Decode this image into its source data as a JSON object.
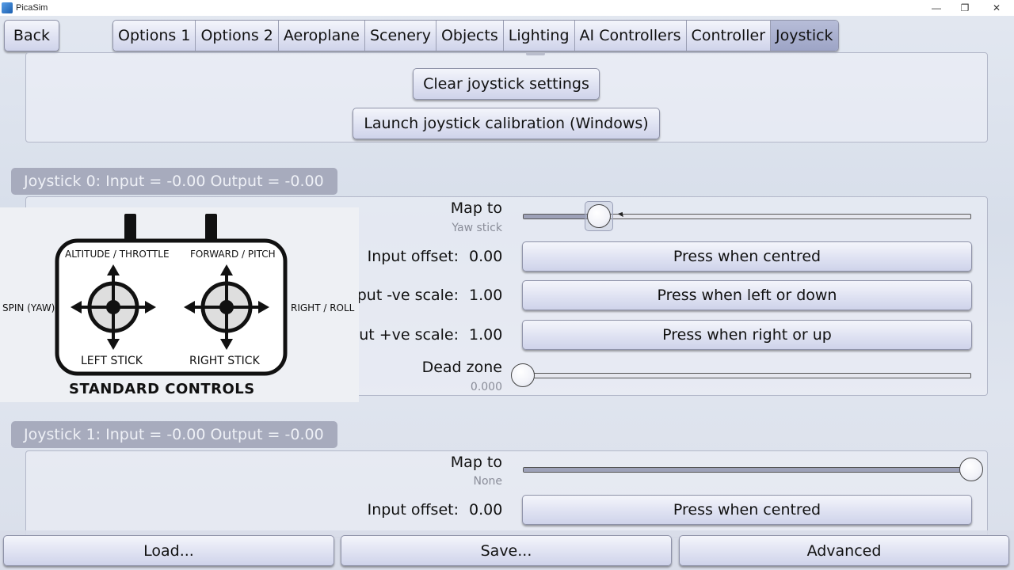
{
  "window": {
    "title": "PicaSim",
    "minimize": "—",
    "maximize": "❐",
    "close": "✕"
  },
  "back_label": "Back",
  "tabs": [
    {
      "label": "Options 1"
    },
    {
      "label": "Options 2"
    },
    {
      "label": "Aeroplane"
    },
    {
      "label": "Scenery"
    },
    {
      "label": "Objects"
    },
    {
      "label": "Lighting"
    },
    {
      "label": "AI Controllers"
    },
    {
      "label": "Controller"
    },
    {
      "label": "Joystick",
      "active": true
    }
  ],
  "top_panel": {
    "clear_label": "Clear joystick settings",
    "launch_label": "Launch joystick calibration (Windows)"
  },
  "joystick0": {
    "header": "Joystick 0: Input = -0.00 Output = -0.00",
    "map_to_label": "Map to",
    "map_to_value": "Yaw stick",
    "map_to_slider": 0.17,
    "input_offset_label": "Input offset:",
    "input_offset_value": "0.00",
    "press_centred": "Press when centred",
    "neg_scale_label": "put -ve scale:",
    "neg_scale_value": "1.00",
    "press_left": "Press when left or down",
    "pos_scale_label": "ut +ve scale:",
    "pos_scale_value": "1.00",
    "press_right": "Press when right or up",
    "dead_zone_label": "Dead zone",
    "dead_zone_value": "0.000",
    "dead_zone_slider": 0.0
  },
  "joystick1": {
    "header": "Joystick 1: Input = -0.00 Output = -0.00",
    "map_to_label": "Map to",
    "map_to_value": "None",
    "map_to_slider": 1.0,
    "input_offset_label": "Input offset:",
    "input_offset_value": "0.00",
    "press_centred": "Press when centred"
  },
  "diagram": {
    "altitude": "ALTITUDE / THROTTLE",
    "forward": "FORWARD / PITCH",
    "spin": "SPIN (YAW)",
    "right_roll": "RIGHT / ROLL",
    "left_stick": "LEFT STICK",
    "right_stick": "RIGHT STICK",
    "title": "STANDARD CONTROLS"
  },
  "bottom": {
    "load": "Load...",
    "save": "Save...",
    "advanced": "Advanced"
  }
}
